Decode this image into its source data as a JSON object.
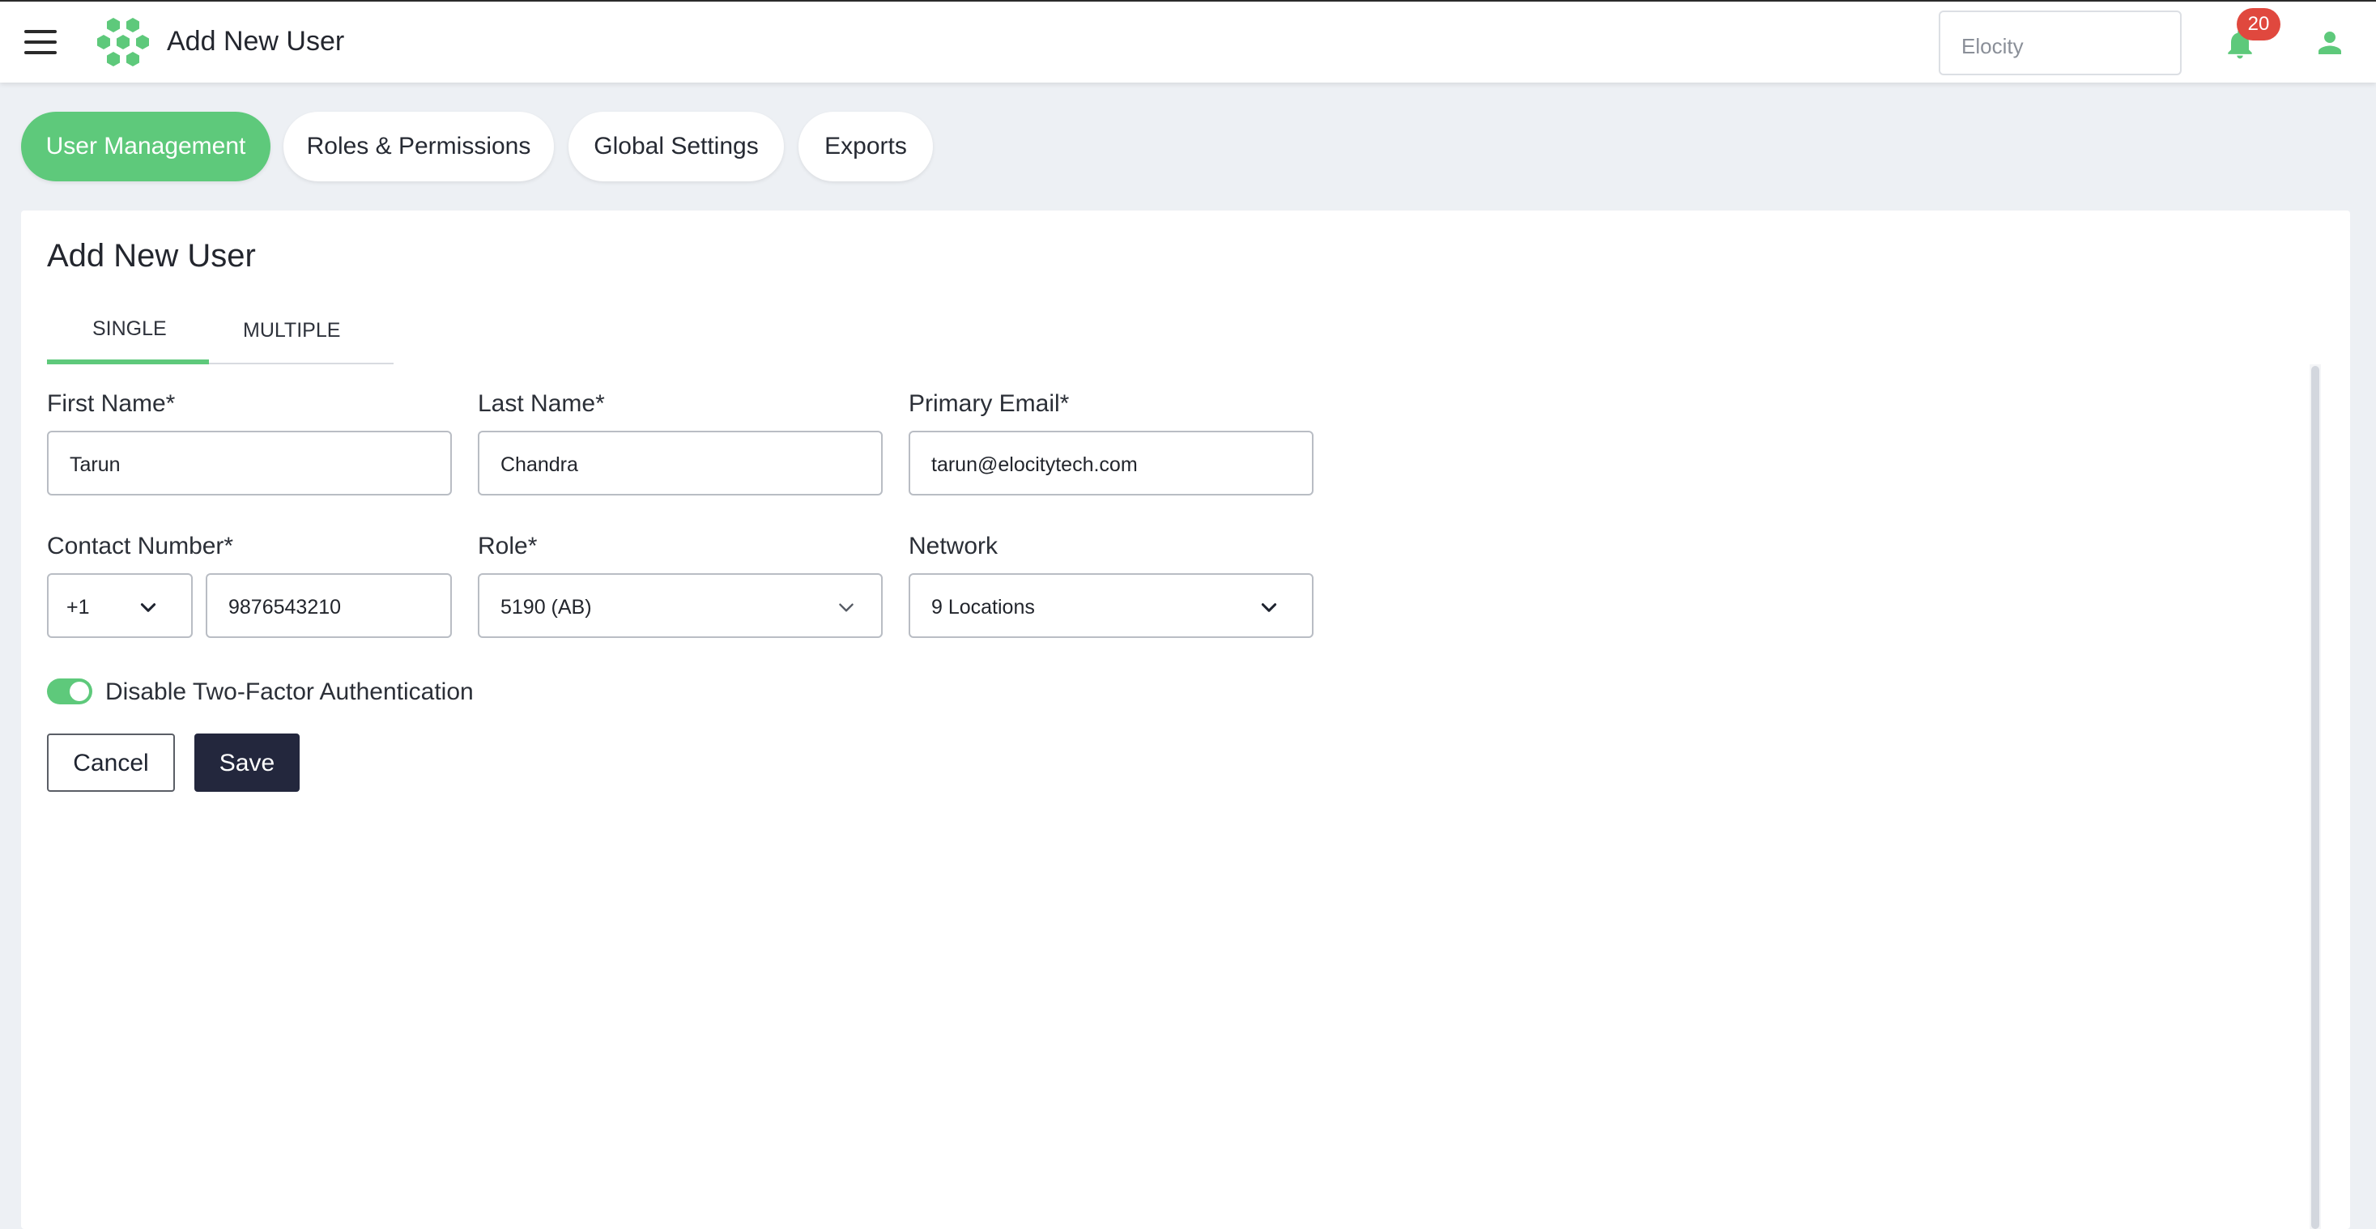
{
  "header": {
    "title": "Add New User",
    "tenant": "Elocity",
    "notification_count": "20",
    "icons": {
      "menu": "hamburger-menu-icon",
      "logo": "hexagon-cluster-logo",
      "notifications": "bell-icon",
      "profile": "user-icon"
    }
  },
  "nav_tabs": [
    {
      "label": "User Management",
      "active": true
    },
    {
      "label": "Roles & Permissions",
      "active": false
    },
    {
      "label": "Global Settings",
      "active": false
    },
    {
      "label": "Exports",
      "active": false
    }
  ],
  "form": {
    "title": "Add New User",
    "subtabs": [
      {
        "label": "SINGLE",
        "active": true
      },
      {
        "label": "MULTIPLE",
        "active": false
      }
    ],
    "first_name": {
      "label": "First Name*",
      "value": "Tarun"
    },
    "last_name": {
      "label": "Last Name*",
      "value": "Chandra"
    },
    "primary_email": {
      "label": "Primary Email*",
      "value": "tarun@elocitytech.com"
    },
    "contact_number": {
      "label": "Contact Number*",
      "country_code": "+1",
      "value": "9876543210"
    },
    "role": {
      "label": "Role*",
      "value": "5190 (AB)"
    },
    "network": {
      "label": "Network",
      "value": "9 Locations"
    },
    "two_factor": {
      "label": "Disable Two-Factor Authentication",
      "enabled": true
    },
    "cancel_label": "Cancel",
    "save_label": "Save"
  },
  "colors": {
    "accent": "#5ec97b",
    "primary_button": "#23273d",
    "badge": "#e0483e",
    "background": "#edf0f4"
  }
}
